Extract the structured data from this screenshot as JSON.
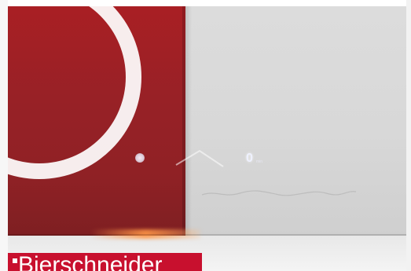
{
  "scene": {
    "description_colors": {
      "panel_red": "#982126",
      "panel_white": "#d8d8d8",
      "label_background": "#c8102e",
      "label_text": "#ffffff"
    }
  },
  "reflections": {
    "digit": "0",
    "digit_suffix": "min"
  },
  "brand_label": {
    "text": "Bierschneider",
    "icon": "square-bullet-icon"
  }
}
